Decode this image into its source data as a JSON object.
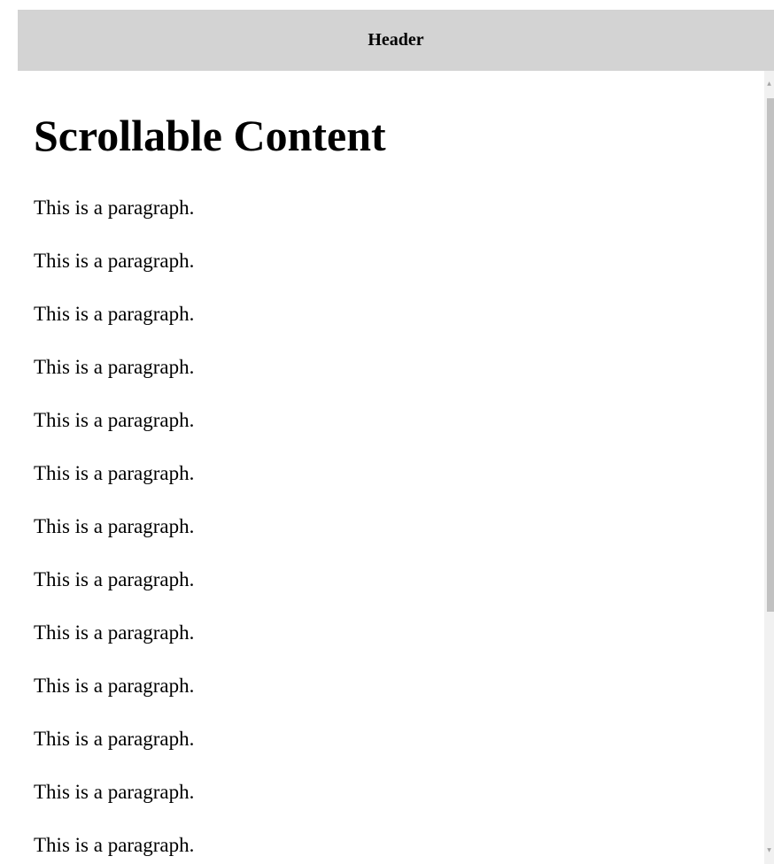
{
  "header": {
    "title": "Header"
  },
  "content": {
    "heading": "Scrollable Content",
    "paragraphs": [
      "This is a paragraph.",
      "This is a paragraph.",
      "This is a paragraph.",
      "This is a paragraph.",
      "This is a paragraph.",
      "This is a paragraph.",
      "This is a paragraph.",
      "This is a paragraph.",
      "This is a paragraph.",
      "This is a paragraph.",
      "This is a paragraph.",
      "This is a paragraph.",
      "This is a paragraph."
    ]
  },
  "scrollbar": {
    "up_arrow_icon": "chevron-up-icon",
    "down_arrow_icon": "chevron-down-icon",
    "up_glyph": "▲",
    "down_glyph": "▼"
  },
  "colors": {
    "header_background": "#d3d3d3",
    "scroll_track": "#f1f1f1",
    "scroll_thumb": "#c1c1c1"
  }
}
